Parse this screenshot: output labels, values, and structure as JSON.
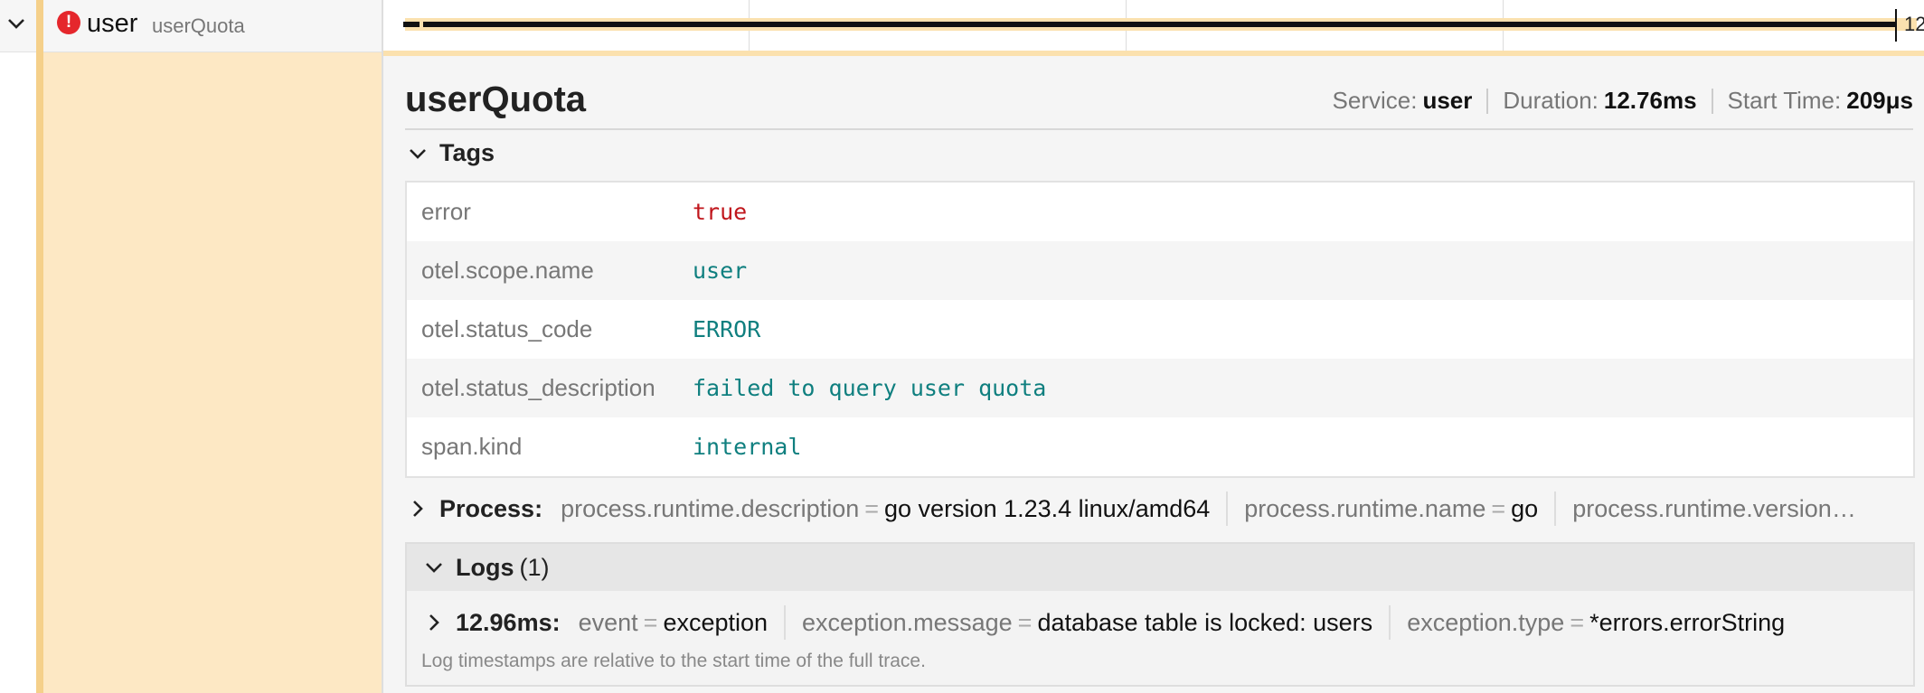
{
  "span_row": {
    "service": "user",
    "operation": "userQuota",
    "timeline_label": "12"
  },
  "detail": {
    "title": "userQuota",
    "meta": {
      "service_label": "Service:",
      "service_value": "user",
      "duration_label": "Duration:",
      "duration_value": "12.76ms",
      "start_label": "Start Time:",
      "start_value": "209μs"
    },
    "tags": {
      "label": "Tags",
      "rows": [
        {
          "key": "error",
          "value": "true"
        },
        {
          "key": "otel.scope.name",
          "value": "user"
        },
        {
          "key": "otel.status_code",
          "value": "ERROR"
        },
        {
          "key": "otel.status_description",
          "value": "failed to query user quota"
        },
        {
          "key": "span.kind",
          "value": "internal"
        }
      ]
    },
    "process": {
      "label": "Process:",
      "items": [
        {
          "key": "process.runtime.description",
          "value": "go version 1.23.4 linux/amd64"
        },
        {
          "key": "process.runtime.name",
          "value": "go"
        },
        {
          "key": "process.runtime.version…",
          "value": ""
        }
      ]
    },
    "logs": {
      "label": "Logs",
      "count": "(1)",
      "entry": {
        "time": "12.96ms:",
        "fields": [
          {
            "key": "event",
            "value": "exception"
          },
          {
            "key": "exception.message",
            "value": "database table is locked: users"
          },
          {
            "key": "exception.type",
            "value": "*errors.errorString"
          }
        ]
      },
      "note": "Log timestamps are relative to the start time of the full trace."
    }
  },
  "colors": {
    "span_bar": "#fbe1ae",
    "span_fill": "#fde8c4",
    "error_icon": "#e5272c",
    "tag_value": "#0f7f7f",
    "error_value": "#c0161c"
  }
}
